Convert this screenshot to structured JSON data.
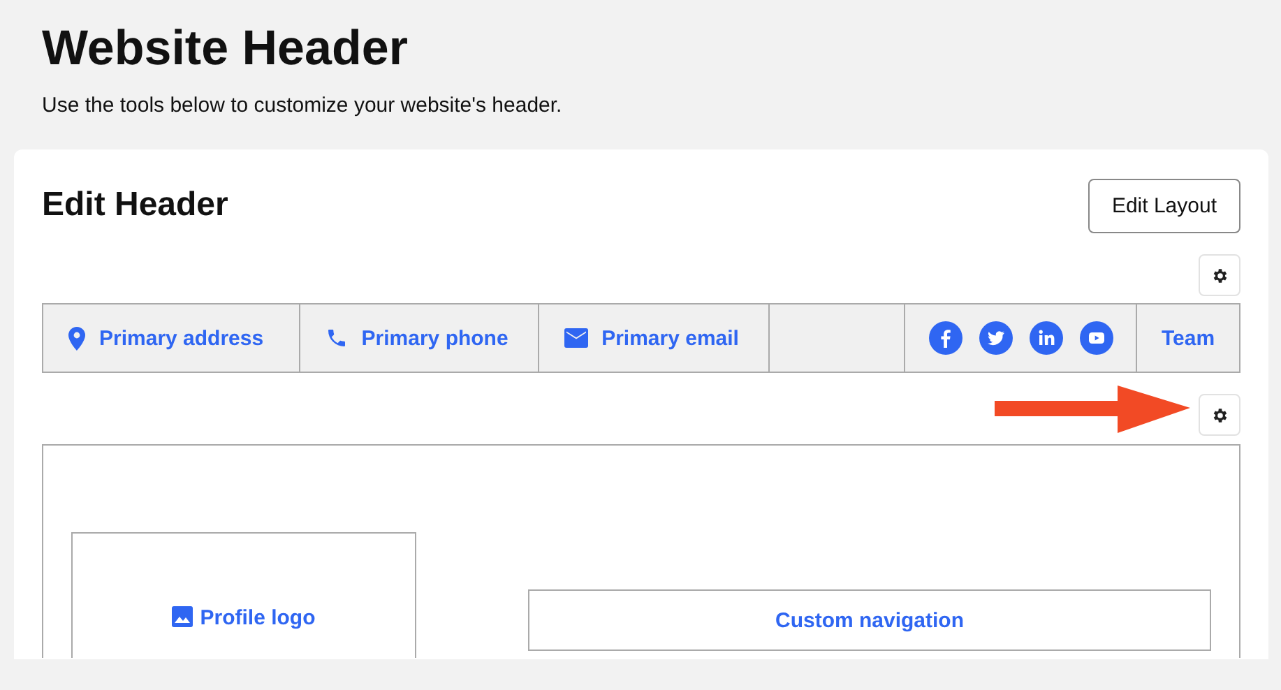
{
  "page": {
    "title": "Website Header",
    "subtitle": "Use the tools below to customize your website's header."
  },
  "card": {
    "title": "Edit Header",
    "layout_button": "Edit Layout"
  },
  "top_bar": [
    {
      "kind": "address",
      "label": "Primary address"
    },
    {
      "kind": "phone",
      "label": "Primary phone"
    },
    {
      "kind": "email",
      "label": "Primary email"
    },
    {
      "kind": "empty"
    },
    {
      "kind": "social",
      "networks": [
        {
          "kind": "facebook"
        },
        {
          "kind": "twitter"
        },
        {
          "kind": "linkedin"
        },
        {
          "kind": "youtube"
        }
      ]
    },
    {
      "kind": "link",
      "label": "Team"
    }
  ],
  "header_preview": {
    "logo": "Profile logo",
    "navigation": "Custom navigation"
  }
}
